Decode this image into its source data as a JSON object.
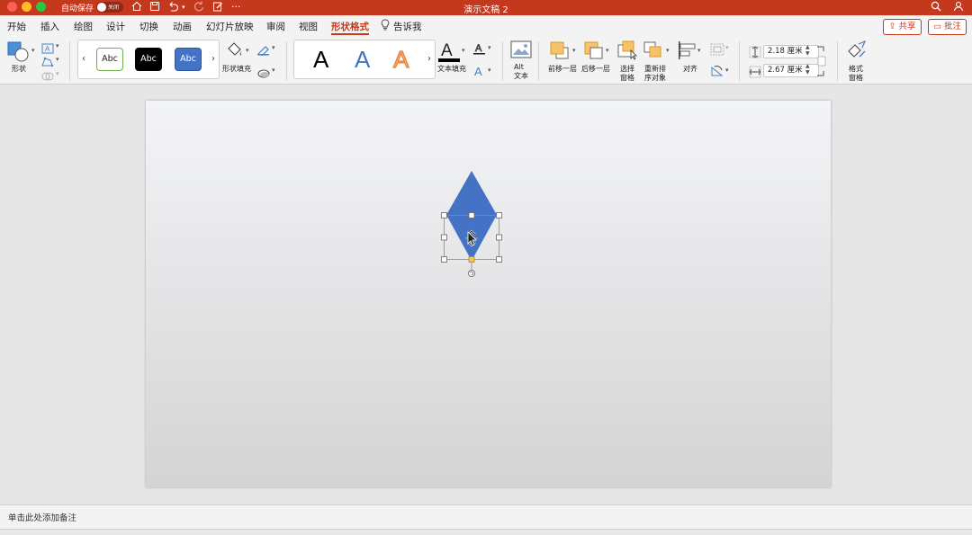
{
  "titlebar": {
    "autosave_label": "自动保存",
    "autosave_state": "关闭",
    "document_title": "演示文稿 2",
    "more": "···",
    "colors": {
      "bar": "#c4391d"
    }
  },
  "tabs": [
    {
      "label": "开始"
    },
    {
      "label": "插入"
    },
    {
      "label": "绘图"
    },
    {
      "label": "设计"
    },
    {
      "label": "切换"
    },
    {
      "label": "动画"
    },
    {
      "label": "幻灯片放映"
    },
    {
      "label": "审阅"
    },
    {
      "label": "视图"
    },
    {
      "label": "形状格式",
      "active": true
    },
    {
      "label": "告诉我"
    }
  ],
  "header_buttons": {
    "share": "共享",
    "comments": "批注"
  },
  "ribbon": {
    "shapes_label": "形状",
    "shape_styles": [
      "Abc",
      "Abc",
      "Abc"
    ],
    "shape_fill_label": "形状填充",
    "wordart": [
      "A",
      "A",
      "A"
    ],
    "text_fill_label": "文本填充",
    "alt_text_label": "Alt\n文本",
    "alt_text_line1": "Alt",
    "alt_text_line2": "文本",
    "bring_forward": "前移一层",
    "send_backward": "后移一层",
    "selection_pane_line1": "选择",
    "selection_pane_line2": "窗格",
    "reorder_line1": "重新排",
    "reorder_line2": "序对象",
    "align": "对齐",
    "height_value": "2.18 厘米",
    "width_value": "2.67 厘米",
    "format_pane_line1": "格式",
    "format_pane_line2": "窗格"
  },
  "notes": {
    "placeholder": "单击此处添加备注"
  },
  "shape": {
    "type": "diamond",
    "fill": "#4472c4"
  }
}
